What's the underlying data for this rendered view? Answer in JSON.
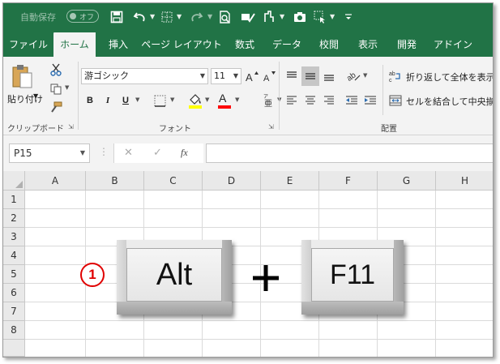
{
  "qat": {
    "autosave_label": "自動保存",
    "autosave_state": "オフ"
  },
  "tabs": [
    "ファイル",
    "ホーム",
    "挿入",
    "ページ レイアウト",
    "数式",
    "データ",
    "校閲",
    "表示",
    "開発",
    "アドイン"
  ],
  "active_tab": "ホーム",
  "ribbon": {
    "clipboard": {
      "paste_label": "貼り付け",
      "group_label": "クリップボード"
    },
    "font": {
      "font_name": "游ゴシック",
      "font_size": "11",
      "bold": "B",
      "italic": "I",
      "underline": "U",
      "font_color_letter": "A",
      "group_label": "フォント",
      "accent_color": "#ffff00",
      "text_color": "#ff0000"
    },
    "alignment": {
      "wrap_text_label": "折り返して全体を表示する",
      "merge_center_label": "セルを結合して中央揃え",
      "group_label": "配置"
    }
  },
  "formula_bar": {
    "name_box": "P15",
    "fx": "fx",
    "cancel": "✕",
    "enter": "✓",
    "value": ""
  },
  "grid": {
    "columns": [
      "A",
      "B",
      "C",
      "D",
      "E",
      "F",
      "G",
      "H"
    ],
    "rows": [
      "1",
      "2",
      "3",
      "4",
      "5",
      "6",
      "7",
      "8"
    ]
  },
  "overlay": {
    "step_number": "1",
    "key1": "Alt",
    "plus": "+",
    "key2": "F11"
  },
  "colors": {
    "excel_green": "#217346",
    "badge_red": "#e00000"
  }
}
